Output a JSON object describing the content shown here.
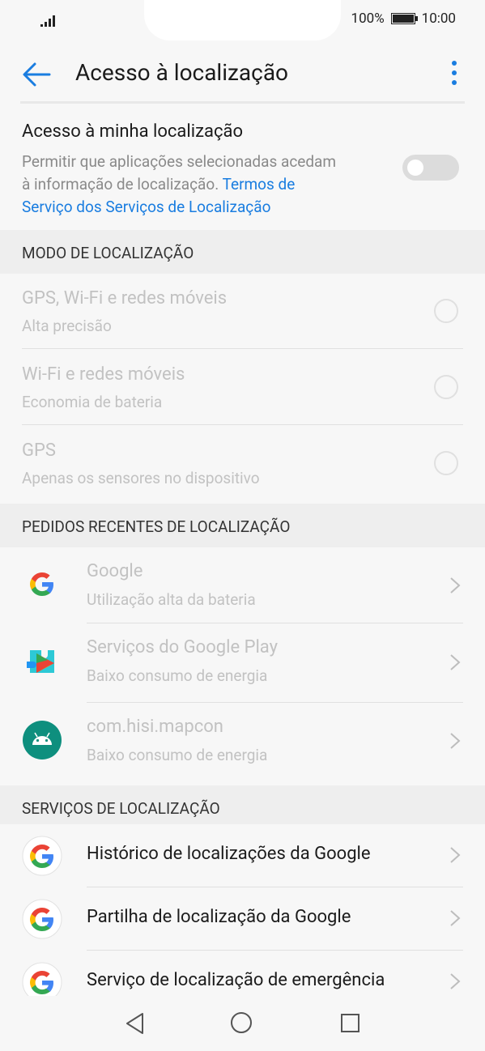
{
  "status": {
    "battery": "100%",
    "time": "10:00"
  },
  "header": {
    "title": "Acesso à localização"
  },
  "access": {
    "title": "Acesso à minha localização",
    "desc_line1": "Permitir que aplicações selecionadas acedam",
    "desc_line2_plain": "à informação de localização. ",
    "desc_link1": "Termos de",
    "desc_link2": "Serviço dos Serviços de Localização",
    "toggle_on": false
  },
  "mode": {
    "header": "MODO DE LOCALIZAÇÃO",
    "items": [
      {
        "title": "GPS, Wi-Fi e redes móveis",
        "sub": "Alta precisão"
      },
      {
        "title": "Wi-Fi e redes móveis",
        "sub": "Economia de bateria"
      },
      {
        "title": "GPS",
        "sub": "Apenas os sensores no dispositivo"
      }
    ]
  },
  "recent": {
    "header": "PEDIDOS RECENTES DE LOCALIZAÇÃO",
    "items": [
      {
        "title": "Google",
        "sub": "Utilização alta da bateria",
        "icon": "google-icon"
      },
      {
        "title": "Serviços do Google Play",
        "sub": "Baixo consumo de energia",
        "icon": "play-services-icon"
      },
      {
        "title": "com.hisi.mapcon",
        "sub": "Baixo consumo de energia",
        "icon": "android-icon"
      }
    ]
  },
  "services": {
    "header": "SERVIÇOS DE LOCALIZAÇÃO",
    "items": [
      {
        "title": "Histórico de localizações da Google",
        "icon": "google-icon"
      },
      {
        "title": "Partilha de localização da Google",
        "icon": "google-icon"
      },
      {
        "title": "Serviço de localização de emergência",
        "icon": "google-icon"
      }
    ]
  },
  "colors": {
    "accent": "#1a7de0",
    "disabled_text": "#c2c2c2"
  }
}
